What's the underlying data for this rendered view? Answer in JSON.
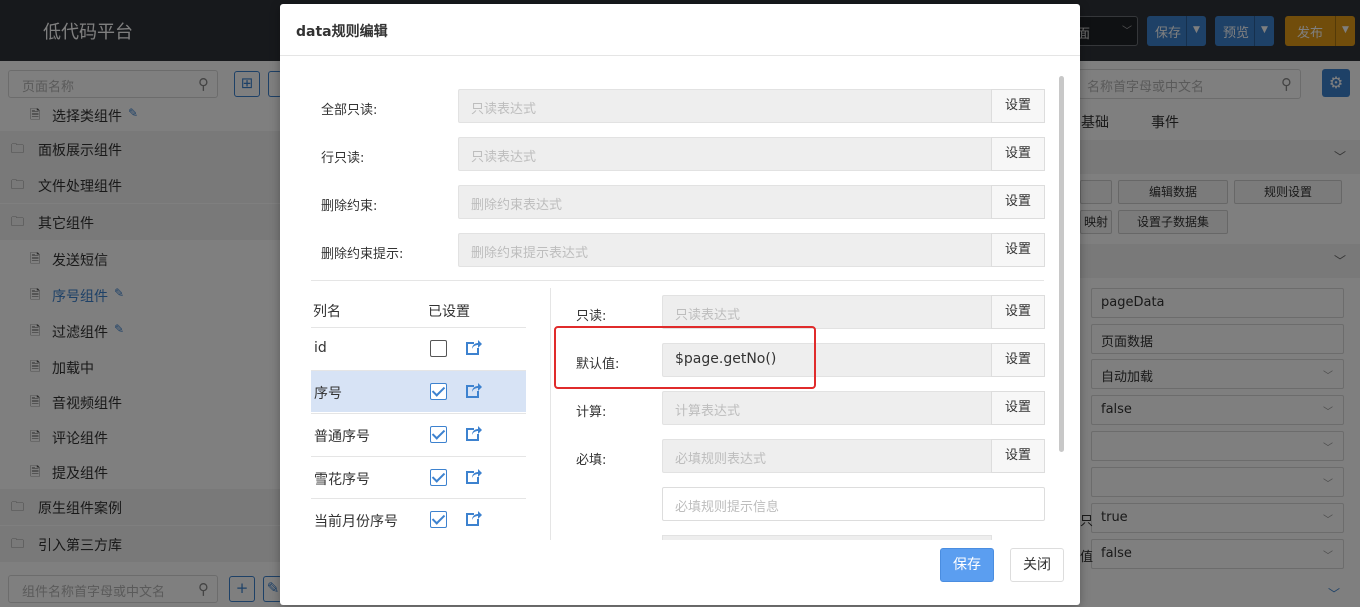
{
  "app": {
    "title": "低代码平台"
  },
  "toolbar": {
    "page_select": "面",
    "save_label": "保存",
    "preview_label": "预览",
    "publish_label": "发布"
  },
  "left": {
    "search_placeholder": "页面名称",
    "component_search_placeholder": "组件名称首字母或中文名",
    "tree": [
      {
        "label": "选择类组件",
        "type": "item",
        "edit": true
      },
      {
        "label": "面板展示组件",
        "type": "group"
      },
      {
        "label": "文件处理组件",
        "type": "group"
      },
      {
        "label": "其它组件",
        "type": "group"
      },
      {
        "label": "发送短信",
        "type": "item"
      },
      {
        "label": "序号组件",
        "type": "item",
        "edit": true,
        "active": true
      },
      {
        "label": "过滤组件",
        "type": "item",
        "edit": true
      },
      {
        "label": "加载中",
        "type": "item"
      },
      {
        "label": "音视频组件",
        "type": "item"
      },
      {
        "label": "评论组件",
        "type": "item"
      },
      {
        "label": "提及组件",
        "type": "item"
      },
      {
        "label": "原生组件案例",
        "type": "group"
      },
      {
        "label": "引入第三方库",
        "type": "group"
      }
    ]
  },
  "right": {
    "search_placeholder": "名称首字母或中文名",
    "tabs": [
      "基础",
      "事件"
    ],
    "buttons": [
      "编辑数据",
      "规则设置",
      "映射",
      "设置子数据集"
    ],
    "fields": [
      {
        "value": "pageData",
        "select": false
      },
      {
        "value": "页面数据",
        "select": false
      },
      {
        "value": "自动加载",
        "select": true
      },
      {
        "value": "false",
        "select": true
      },
      {
        "value": "",
        "select": true
      },
      {
        "value": "",
        "select": true
      },
      {
        "value": "true",
        "select": true,
        "label": "只"
      },
      {
        "value": "false",
        "select": true,
        "label": "值"
      }
    ]
  },
  "modal": {
    "title": "data规则编辑",
    "global_rules": [
      {
        "label": "全部只读:",
        "placeholder": "只读表达式",
        "button": "设置"
      },
      {
        "label": "行只读:",
        "placeholder": "只读表达式",
        "button": "设置"
      },
      {
        "label": "删除约束:",
        "placeholder": "删除约束表达式",
        "button": "设置"
      },
      {
        "label": "删除约束提示:",
        "placeholder": "删除约束提示表达式",
        "button": "设置"
      }
    ],
    "columns_header": {
      "name": "列名",
      "set": "已设置"
    },
    "columns": [
      {
        "name": "id",
        "checked": false
      },
      {
        "name": "序号",
        "checked": true,
        "selected": true
      },
      {
        "name": "普通序号",
        "checked": true
      },
      {
        "name": "雪花序号",
        "checked": true
      },
      {
        "name": "当前月份序号",
        "checked": true
      }
    ],
    "col_rules": [
      {
        "label": "只读:",
        "placeholder": "只读表达式",
        "value": "",
        "button": "设置"
      },
      {
        "label": "默认值:",
        "placeholder": "",
        "value": "$page.getNo()",
        "button": "设置"
      },
      {
        "label": "计算:",
        "placeholder": "计算表达式",
        "value": "",
        "button": "设置"
      },
      {
        "label": "必填:",
        "placeholder": "必填规则表达式",
        "value": "",
        "button": "设置"
      }
    ],
    "required_tip_placeholder": "必填规则提示信息",
    "save_label": "保存",
    "close_label": "关闭"
  }
}
